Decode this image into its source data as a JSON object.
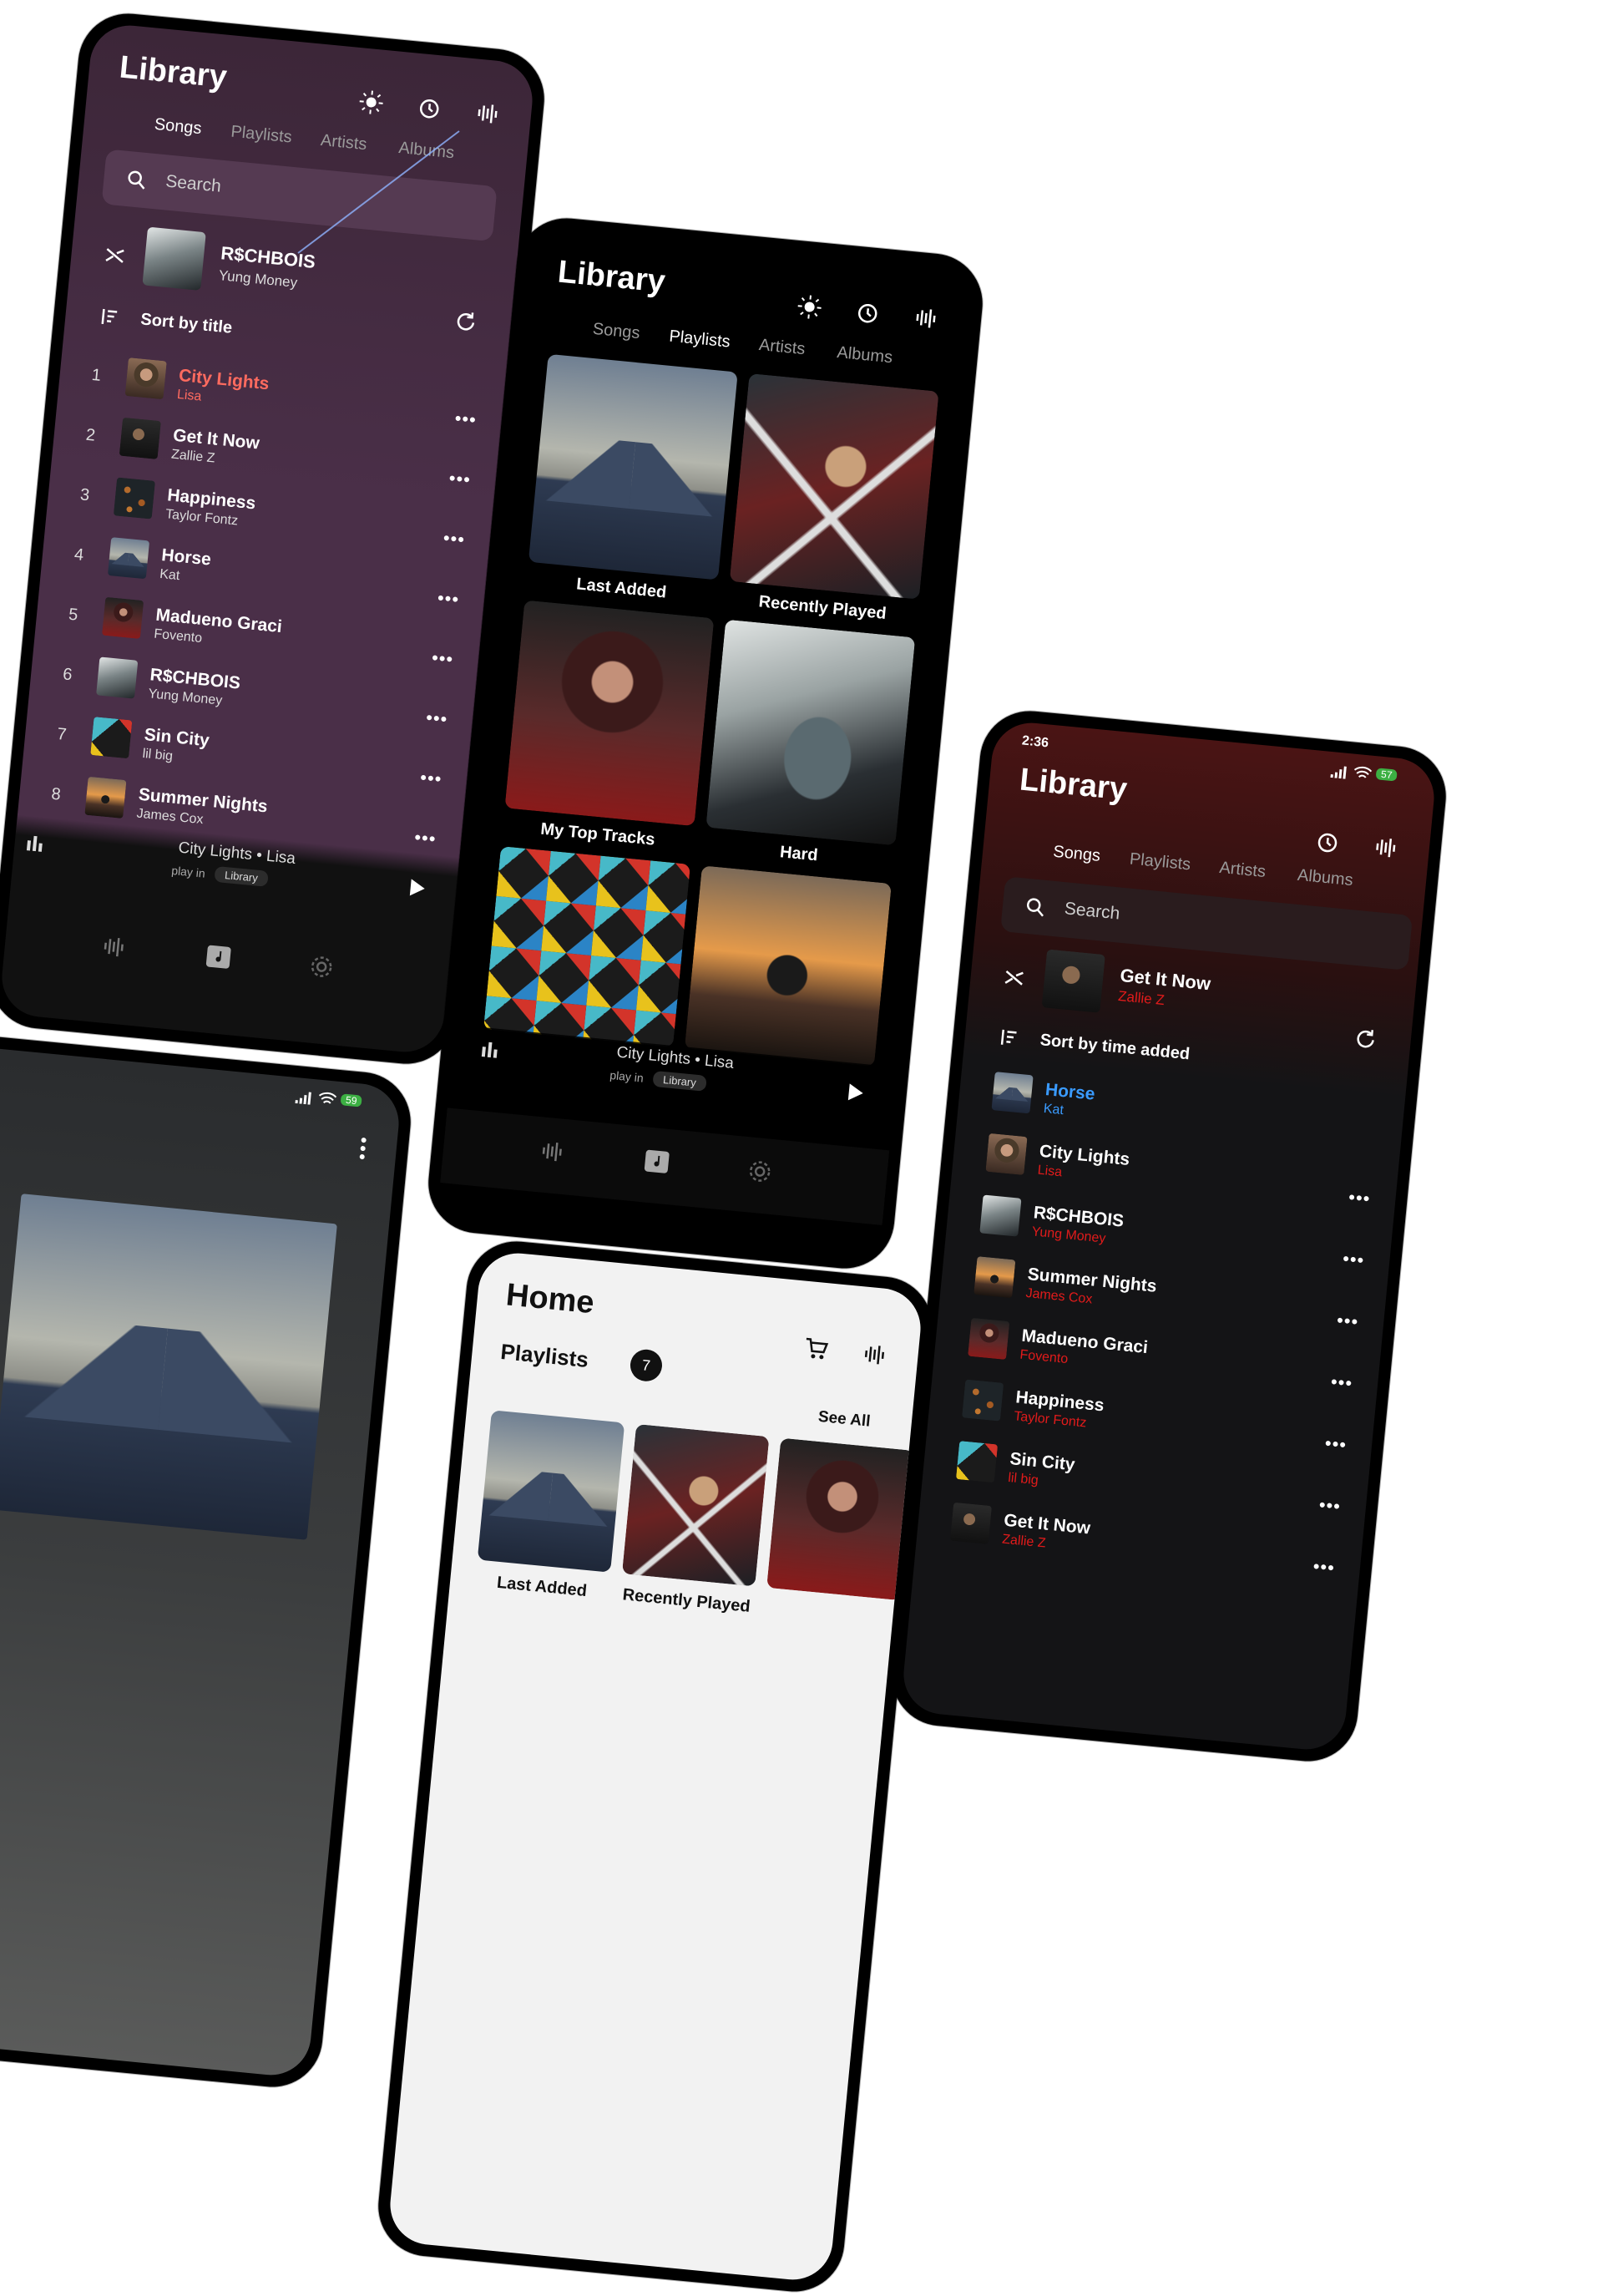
{
  "phone_purple": {
    "title": "Library",
    "tabs": [
      "Songs",
      "Playlists",
      "Artists",
      "Albums"
    ],
    "search_placeholder": "Search",
    "current": {
      "title": "R$CHBOIS",
      "artist": "Yung Money"
    },
    "sort_label": "Sort by title",
    "songs": [
      {
        "num": "1",
        "title": "City Lights",
        "artist": "Lisa"
      },
      {
        "num": "2",
        "title": "Get It Now",
        "artist": "Zallie Z"
      },
      {
        "num": "3",
        "title": "Happiness",
        "artist": "Taylor Fontz"
      },
      {
        "num": "4",
        "title": "Horse",
        "artist": "Kat"
      },
      {
        "num": "5",
        "title": "Madueno Graci",
        "artist": "Fovento"
      },
      {
        "num": "6",
        "title": "R$CHBOIS",
        "artist": "Yung Money"
      },
      {
        "num": "7",
        "title": "Sin City",
        "artist": "lil big"
      },
      {
        "num": "8",
        "title": "Summer Nights",
        "artist": "James Cox"
      }
    ],
    "mini_player": {
      "title": "City Lights • Lisa",
      "play_in": "play in",
      "chip": "Library"
    },
    "highlight_color": "#ff6b5f"
  },
  "phone_black": {
    "title": "Library",
    "tabs": [
      "Songs",
      "Playlists",
      "Artists",
      "Albums"
    ],
    "playlists": [
      "Last Added",
      "Recently Played",
      "My Top Tracks",
      "Hard"
    ],
    "mini_player": {
      "title": "City Lights • Lisa",
      "play_in": "play in",
      "chip": "Library"
    }
  },
  "phone_red": {
    "time": "2:36",
    "battery": "57",
    "title": "Library",
    "tabs": [
      "Songs",
      "Playlists",
      "Artists",
      "Albums"
    ],
    "search_placeholder": "Search",
    "current": {
      "title": "Get It Now",
      "artist": "Zallie Z"
    },
    "sort_label": "Sort by time added",
    "songs": [
      {
        "title": "Horse",
        "artist": "Kat"
      },
      {
        "title": "City Lights",
        "artist": "Lisa"
      },
      {
        "title": "R$CHBOIS",
        "artist": "Yung Money"
      },
      {
        "title": "Summer Nights",
        "artist": "James Cox"
      },
      {
        "title": "Madueno Graci",
        "artist": "Fovento"
      },
      {
        "title": "Happiness",
        "artist": "Taylor Fontz"
      },
      {
        "title": "Sin City",
        "artist": "lil big"
      },
      {
        "title": "Get It Now",
        "artist": "Zallie Z"
      }
    ],
    "highlight_color": "#3a9bff",
    "artist_color": "#e11b1b"
  },
  "phone_gray": {
    "battery": "59"
  },
  "phone_home": {
    "title": "Home",
    "section": "Playlists",
    "count": "7",
    "see_all": "See All",
    "playlists": [
      "Last Added",
      "Recently Played"
    ]
  }
}
